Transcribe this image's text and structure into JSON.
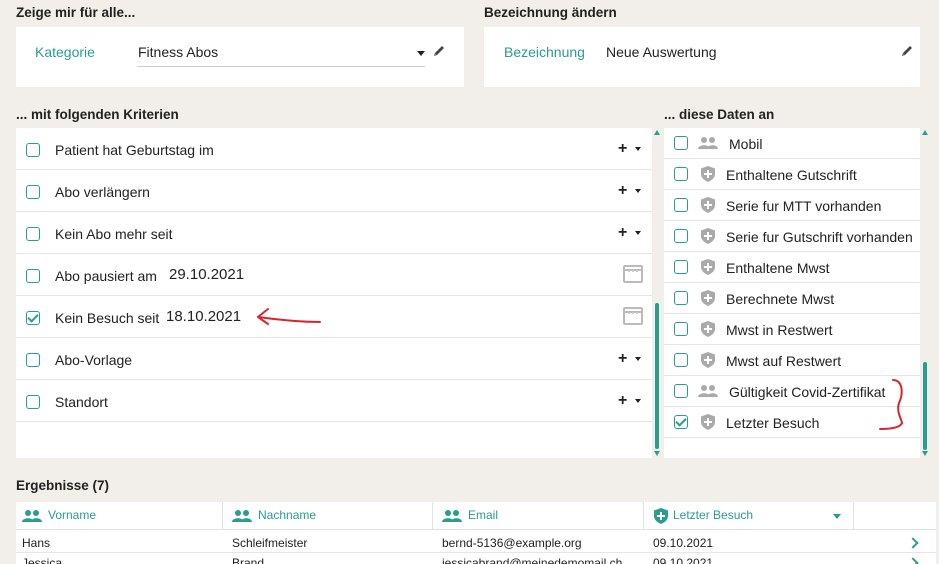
{
  "filter_section": {
    "title": "Zeige mir für alle...",
    "category_label": "Kategorie",
    "category_value": "Fitness Abos"
  },
  "rename_section": {
    "title": "Bezeichnung ändern",
    "name_label": "Bezeichnung",
    "name_value": "Neue Auswertung"
  },
  "criteria": {
    "title": "... mit folgenden Kriterien",
    "items": [
      {
        "label": "Patient hat Geburtstag im",
        "checked": false,
        "value": "",
        "control": "plus"
      },
      {
        "label": "Abo verlängern",
        "checked": false,
        "value": "",
        "control": "plus"
      },
      {
        "label": "Kein Abo mehr seit",
        "checked": false,
        "value": "",
        "control": "plus"
      },
      {
        "label": "Abo pausiert am",
        "checked": false,
        "value": "29.10.2021",
        "control": "calendar"
      },
      {
        "label": "Kein Besuch seit",
        "checked": true,
        "value": "18.10.2021",
        "control": "calendar"
      },
      {
        "label": "Abo-Vorlage",
        "checked": false,
        "value": "",
        "control": "plus"
      },
      {
        "label": "Standort",
        "checked": false,
        "value": "",
        "control": "plus"
      }
    ]
  },
  "data_fields": {
    "title": "... diese Daten an",
    "items": [
      {
        "label": "Mobil",
        "checked": false,
        "icon": "people-icon"
      },
      {
        "label": "Enthaltene Gutschrift",
        "checked": false,
        "icon": "shield-icon"
      },
      {
        "label": "Serie fur MTT vorhanden",
        "checked": false,
        "icon": "shield-icon"
      },
      {
        "label": "Serie fur Gutschrift vorhanden",
        "checked": false,
        "icon": "shield-icon"
      },
      {
        "label": "Enthaltene Mwst",
        "checked": false,
        "icon": "shield-icon"
      },
      {
        "label": "Berechnete Mwst",
        "checked": false,
        "icon": "shield-icon"
      },
      {
        "label": "Mwst in Restwert",
        "checked": false,
        "icon": "shield-icon"
      },
      {
        "label": "Mwst auf Restwert",
        "checked": false,
        "icon": "shield-icon"
      },
      {
        "label": "Gültigkeit Covid-Zertifikat",
        "checked": false,
        "icon": "people-icon"
      },
      {
        "label": "Letzter Besuch",
        "checked": true,
        "icon": "shield-icon"
      }
    ]
  },
  "results": {
    "title": "Ergebnisse (7)",
    "columns": [
      {
        "label": "Vorname",
        "icon": "people-icon"
      },
      {
        "label": "Nachname",
        "icon": "people-icon"
      },
      {
        "label": "Email",
        "icon": "people-icon"
      },
      {
        "label": "Letzter Besuch",
        "icon": "shield-icon",
        "sorted": "desc"
      }
    ],
    "rows": [
      [
        "Hans",
        "Schleifmeister",
        "bernd-5136@example.org",
        "09.10.2021"
      ],
      [
        "Jessica",
        "Brand",
        "jessicabrand@meinedemomail.ch",
        "09.10.2021"
      ]
    ]
  },
  "colors": {
    "accent": "#2a9d8f",
    "annotation": "#d9262c",
    "background": "#f2efea"
  }
}
